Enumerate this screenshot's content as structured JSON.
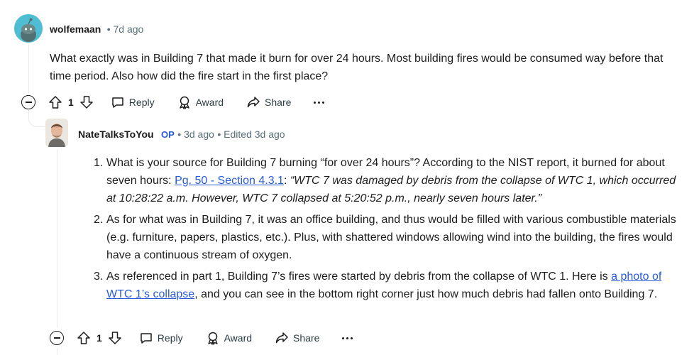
{
  "comment1": {
    "username": "wolfemaan",
    "time": "7d ago",
    "body": "What exactly was in Building 7 that made it burn for over 24 hours. Most building fires would be consumed way before that time period. Also how did the fire start in the first place?",
    "score": "1",
    "reply_label": "Reply",
    "award_label": "Award",
    "share_label": "Share"
  },
  "comment2": {
    "username": "NateTalksToYou",
    "op_badge": "OP",
    "time": "3d ago",
    "edited": "Edited 3d ago",
    "items": [
      {
        "num": "1.",
        "text_a": "What is your source for Building 7 burning “for over 24 hours”? According to the NIST report, it burned for about seven hours: ",
        "link": "Pg. 50 - Section 4.3.1",
        "text_b": ": ",
        "quote": "“WTC 7 was damaged by debris from the collapse of WTC 1, which occurred at 10:28:22 a.m. However, WTC 7 collapsed at 5:20:52 p.m., nearly seven hours later.”"
      },
      {
        "num": "2.",
        "text": "As for what was in Building 7, it was an office building, and thus would be filled with various combustible materials (e.g. furniture, papers, plastics, etc.). Plus, with shattered windows allowing wind into the building, the fires would have a continuous stream of oxygen."
      },
      {
        "num": "3.",
        "text_a": "As referenced in part 1, Building 7’s fires were started by debris from the collapse of WTC 1. Here is ",
        "link": "a photo of WTC 1’s collapse",
        "text_b": ", and you can see in the bottom right corner just how much debris had fallen onto Building 7."
      }
    ],
    "score": "1",
    "reply_label": "Reply",
    "award_label": "Award",
    "share_label": "Share"
  },
  "colors": {
    "link": "#2a5bd7",
    "meta": "#576f76",
    "thread_line": "#e5ebee",
    "avatar_bg": "#4fbdd4"
  },
  "icons": [
    "snoo-avatar-icon",
    "collapse-icon",
    "upvote-icon",
    "downvote-icon",
    "reply-icon",
    "award-icon",
    "share-icon",
    "more-options-icon"
  ]
}
